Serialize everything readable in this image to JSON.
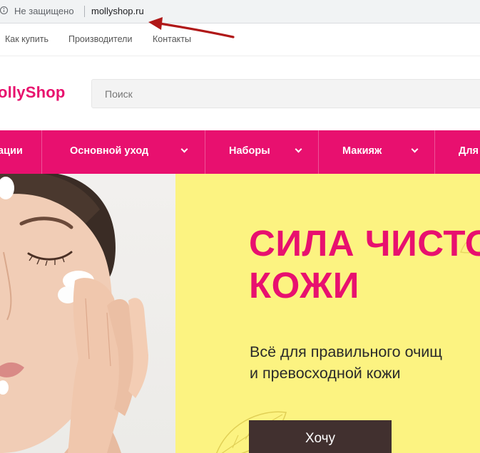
{
  "browser": {
    "security_label": "Не защищено",
    "url": "mollyshop.ru"
  },
  "top_links": [
    "Как купить",
    "Производители",
    "Контакты"
  ],
  "header": {
    "logo_text": "ollyShop",
    "search_placeholder": "Поиск"
  },
  "nav": {
    "items": [
      {
        "label": "ации",
        "has_dropdown": false
      },
      {
        "label": "Основной уход",
        "has_dropdown": true
      },
      {
        "label": "Наборы",
        "has_dropdown": true
      },
      {
        "label": "Макияж",
        "has_dropdown": true
      },
      {
        "label": "Для",
        "has_dropdown": false
      }
    ]
  },
  "hero": {
    "title_line1": "СИЛА ЧИСТО",
    "title_line2": "КОЖИ",
    "subtitle_line1": "Всё для правильного очищ",
    "subtitle_line2": "и превосходной кожи",
    "cta_label": "Хочу"
  },
  "colors": {
    "accent_pink": "#e8106f",
    "banner_yellow": "#fcf381",
    "cta_brown": "#41302f",
    "arrow_red": "#b01818"
  },
  "icons": [
    "info-icon",
    "chevron-down-icon",
    "red-arrow-annotation"
  ]
}
